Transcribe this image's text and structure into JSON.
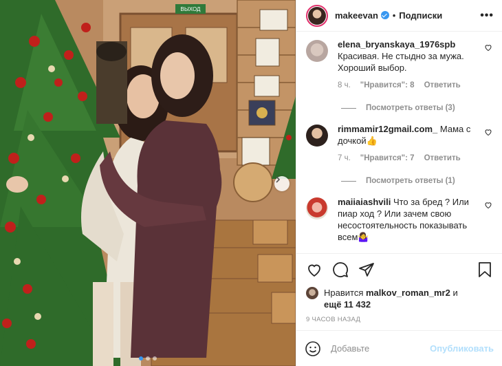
{
  "post": {
    "image_alt": "",
    "photo_dots": 3,
    "active_dot": 0
  },
  "header": {
    "username": "makeevan",
    "verified": true,
    "separator": "•",
    "follow_label": "Подписки",
    "more_label": "•••"
  },
  "comments": [
    {
      "user": "elena_bryanskaya_1976spb",
      "text": "Красивая. Не стыдно за мужа. Хороший выбор.",
      "time": "8 ч.",
      "likes": "\"Нравится\": 8",
      "reply_label": "Ответить",
      "view_replies": "Посмотреть ответы (3)"
    },
    {
      "user": "rimmamir12gmail.com_",
      "text": "Мама с дочкой👍",
      "time": "7 ч.",
      "likes": "\"Нравится\": 7",
      "reply_label": "Ответить",
      "view_replies": "Посмотреть ответы (1)"
    },
    {
      "user": "maiiaiashvili",
      "text": "Что за бред ? Или пиар ход ? Или зачем свою несостоятельность показывать всем🤷‍♀️",
      "time": "",
      "likes": "",
      "reply_label": "",
      "view_replies": ""
    }
  ],
  "actions": {
    "liked_by_prefix": "Нравится",
    "liked_by_user": "malkov_roman_mr2",
    "liked_by_suffix": "и",
    "liked_by_more": "ещё 11 432",
    "time_ago": "9 ЧАСОВ НАЗАД"
  },
  "composer": {
    "placeholder": "Добавьте",
    "publish_label": "Опубликовать"
  },
  "icons": {
    "verified": "verified-badge-icon",
    "more": "more-icon",
    "heart": "heart-icon",
    "comment": "comment-icon",
    "share": "share-icon",
    "bookmark": "bookmark-icon",
    "emoji": "emoji-icon",
    "next": "chevron-right-icon"
  },
  "colors": {
    "link_blue": "#3897f0",
    "publish_disabled": "#b2dffc",
    "muted": "#8e8e8e",
    "text": "#262626"
  }
}
